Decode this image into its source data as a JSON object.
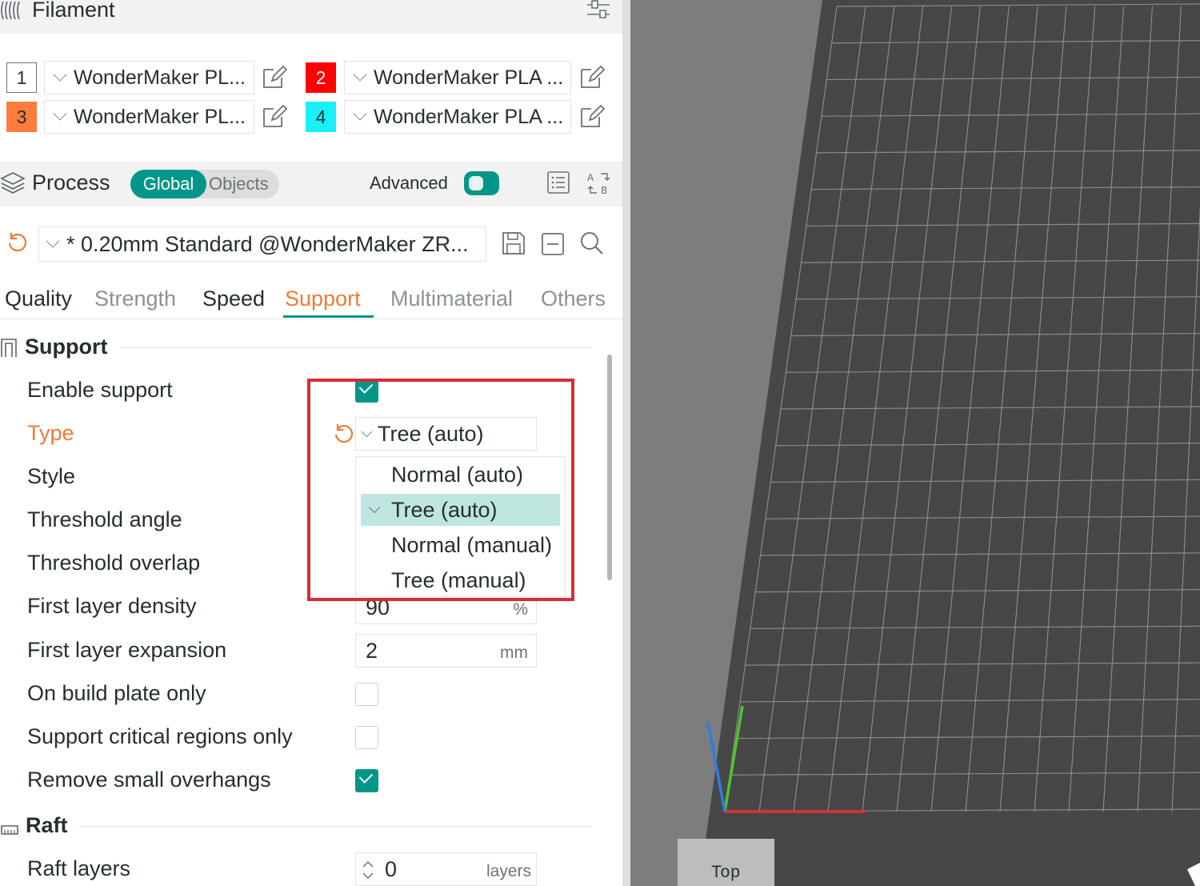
{
  "filament": {
    "title": "Filament",
    "slots": [
      {
        "number": "1",
        "name": "WonderMaker PL...",
        "color": "#ffffff"
      },
      {
        "number": "2",
        "name": "WonderMaker PLA ...",
        "color": "#ff0000"
      },
      {
        "number": "3",
        "name": "WonderMaker PL...",
        "color": "#ff7c3c"
      },
      {
        "number": "4",
        "name": "WonderMaker PLA ...",
        "color": "#18f0f8"
      }
    ]
  },
  "process": {
    "title": "Process",
    "scope_active": "Global",
    "scope_other": "Objects",
    "advanced_label": "Advanced",
    "advanced_on": true,
    "preset": "* 0.20mm Standard @WonderMaker ZR..."
  },
  "tabs": [
    "Quality",
    "Strength",
    "Speed",
    "Support",
    "Multimaterial",
    "Others"
  ],
  "active_tab": "Support",
  "support_group": {
    "title": "Support",
    "enable_support": {
      "label": "Enable support",
      "checked": true
    },
    "type": {
      "label": "Type",
      "value": "Tree (auto)"
    },
    "style": {
      "label": "Style"
    },
    "threshold_angle": {
      "label": "Threshold angle"
    },
    "threshold_overlap": {
      "label": "Threshold overlap"
    },
    "first_layer_density": {
      "label": "First layer density",
      "value": "90",
      "unit": "%"
    },
    "first_layer_expansion": {
      "label": "First layer expansion",
      "value": "2",
      "unit": "mm"
    },
    "on_build_plate_only": {
      "label": "On build plate only",
      "checked": false
    },
    "support_critical_regions_only": {
      "label": "Support critical regions only",
      "checked": false
    },
    "remove_small_overhangs": {
      "label": "Remove small overhangs",
      "checked": true
    }
  },
  "type_dropdown": {
    "options": [
      "Normal (auto)",
      "Tree (auto)",
      "Normal (manual)",
      "Tree (manual)"
    ],
    "selected": "Tree (auto)"
  },
  "raft_group": {
    "title": "Raft",
    "raft_layers": {
      "label": "Raft layers",
      "value": "0",
      "unit": "layers"
    }
  },
  "viewport": {
    "view_label": "Top"
  },
  "colors": {
    "accent": "#009688",
    "changed": "#f07a33",
    "highlight_box": "#d92b35",
    "bed": "#4a4a4a",
    "grid": "#8a8a8a"
  }
}
